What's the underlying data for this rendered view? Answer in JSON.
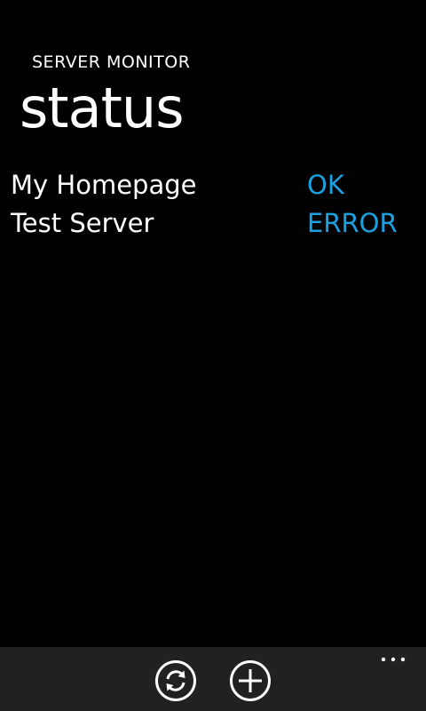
{
  "header": {
    "app_title": "SERVER MONITOR",
    "page_title": "status"
  },
  "servers": [
    {
      "name": "My Homepage",
      "status": "OK"
    },
    {
      "name": "Test Server",
      "status": "ERROR"
    }
  ],
  "colors": {
    "background": "#000000",
    "text": "#ffffff",
    "accent": "#1ba1e2",
    "app_bar": "#212121"
  },
  "app_bar": {
    "buttons": [
      {
        "icon": "refresh-icon"
      },
      {
        "icon": "add-icon"
      }
    ],
    "more_icon": "ellipsis-icon"
  }
}
